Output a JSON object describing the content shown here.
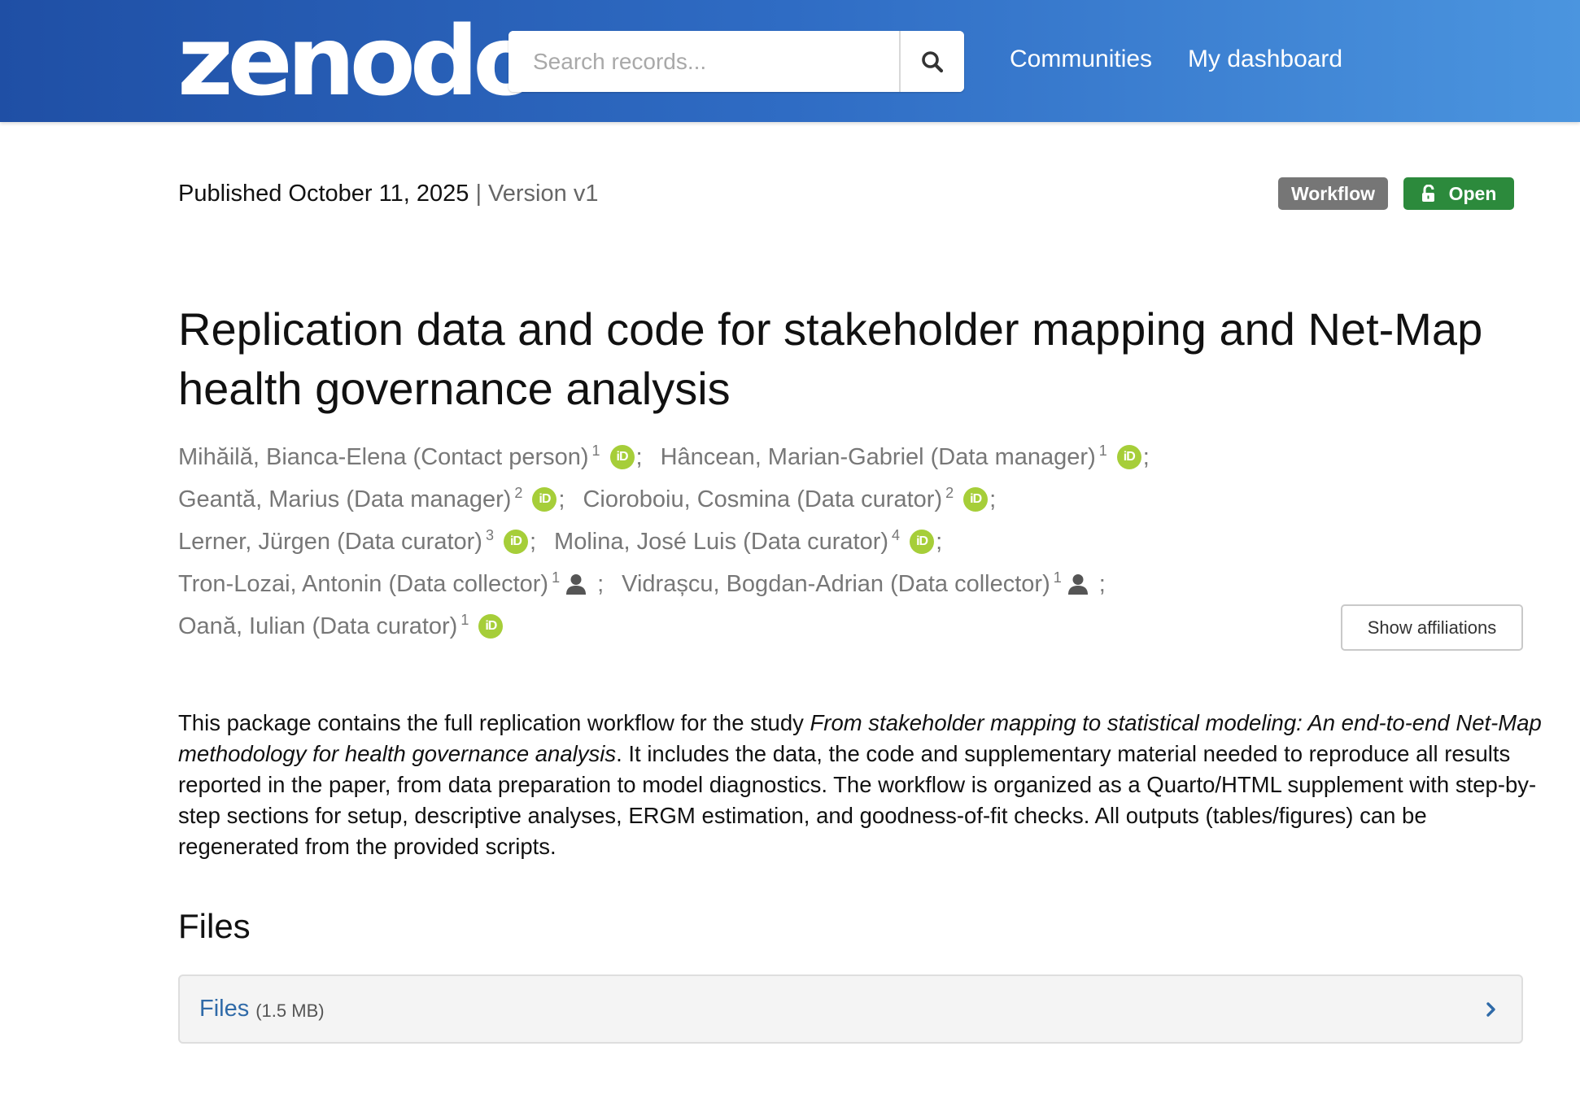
{
  "header": {
    "logo_text": "zenodo",
    "search_placeholder": "Search records...",
    "nav": [
      {
        "label": "Communities"
      },
      {
        "label": "My dashboard"
      }
    ],
    "colors": {
      "gradient_start": "#1f4fa5",
      "gradient_end": "#4b95df"
    }
  },
  "record": {
    "published": "Published October 11, 2025",
    "version": "| Version v1",
    "badges": {
      "type": "Workflow",
      "access": "Open"
    },
    "title": "Replication data and code for stakeholder mapping and Net-Map health governance analysis",
    "creators": [
      {
        "name": "Mihăilă, Bianca-Elena (Contact person)",
        "aff": "1",
        "id_type": "orcid-icon"
      },
      {
        "name": "Hâncean, Marian-Gabriel (Data manager)",
        "aff": "1",
        "id_type": "orcid-icon"
      },
      {
        "name": "Geantă, Marius (Data manager)",
        "aff": "2",
        "id_type": "orcid-icon"
      },
      {
        "name": "Cioroboiu, Cosmina (Data curator)",
        "aff": "2",
        "id_type": "orcid-icon"
      },
      {
        "name": "Lerner, Jürgen (Data curator)",
        "aff": "3",
        "id_type": "orcid-icon"
      },
      {
        "name": "Molina, José Luis (Data curator)",
        "aff": "4",
        "id_type": "orcid-icon"
      },
      {
        "name": "Tron-Lozai, Antonin (Data collector)",
        "aff": "1",
        "id_type": "person-icon"
      },
      {
        "name": "Vidrașcu, Bogdan-Adrian (Data collector)",
        "aff": "1",
        "id_type": "person-icon"
      },
      {
        "name": "Oană, Iulian (Data curator)",
        "aff": "1",
        "id_type": "orcid-icon"
      }
    ],
    "orcid_text": "iD",
    "separator": ";",
    "show_affiliations": "Show affiliations",
    "description": {
      "intro": "This package contains the full replication workflow for the study ",
      "study_title": "From stakeholder mapping to statistical modeling: An end-to-end Net-Map methodology for health governance analysis",
      "body": ". It includes the data, the code and supplementary material needed to reproduce all results reported in the paper, from data preparation to model diagnostics. The workflow is organized as a Quarto/HTML supplement with step-by-step sections for setup, descriptive analyses, ERGM estimation, and goodness-of-fit checks. All outputs (tables/figures) can be regenerated from the provided scripts."
    }
  },
  "files": {
    "heading": "Files",
    "panel_label": "Files",
    "size": "(1.5 MB)"
  },
  "colors": {
    "badge_workflow": "#767676",
    "badge_open": "#2c8a3c",
    "orcid": "#a6ce39",
    "link": "#2f6aa8"
  }
}
